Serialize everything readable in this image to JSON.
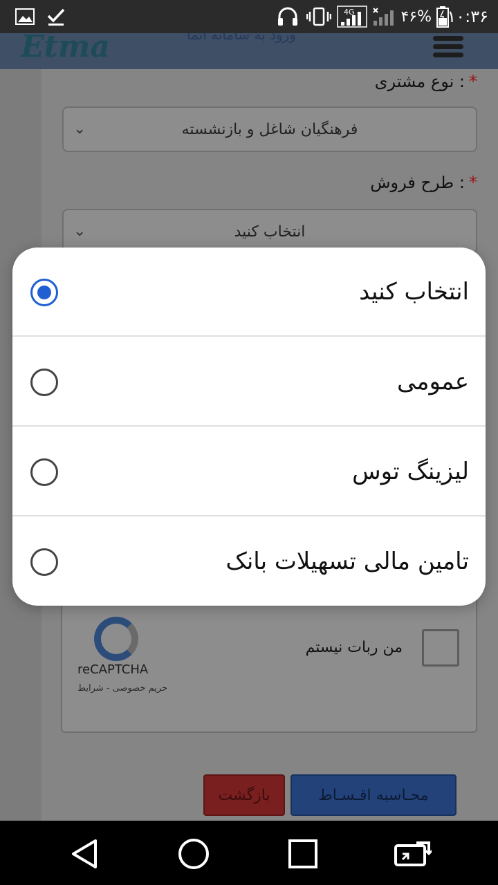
{
  "status_bar": {
    "time": "۱۰:۳۶",
    "battery_percent": "۴۶%",
    "network": "4G",
    "icons": [
      "gallery-icon",
      "check-icon",
      "headset-icon",
      "vibrate-icon",
      "signal-4g-icon",
      "signal-icon",
      "battery-icon"
    ]
  },
  "header": {
    "logo": "Etma",
    "login_link": "ورود به سامانه اتما"
  },
  "form": {
    "customer_type_label": "نوع مشتری :",
    "customer_type_value": "فرهنگیان شاغل و بازنشسته",
    "sales_plan_label": "طرح فروش :",
    "sales_plan_value": "انتخاب کنید",
    "required_mark": "*"
  },
  "captcha": {
    "checkbox_label": "من ربات نیستم",
    "brand": "reCAPTCHA",
    "links": "حریم خصوصی - شرایط"
  },
  "buttons": {
    "back": "بازگشت",
    "calculate": "محـاسبه اقـسـاط"
  },
  "dialog": {
    "options": [
      {
        "label": "انتخاب کنید",
        "selected": true
      },
      {
        "label": "عمومی",
        "selected": false
      },
      {
        "label": "لیزینگ توس",
        "selected": false
      },
      {
        "label": "تامین مالی تسهیلات بانک",
        "selected": false
      }
    ],
    "accent_color": "#1f5fd2"
  },
  "nav_bar": {
    "icons": [
      "back-icon",
      "home-icon",
      "recents-icon",
      "screen-rotate-icon"
    ]
  }
}
